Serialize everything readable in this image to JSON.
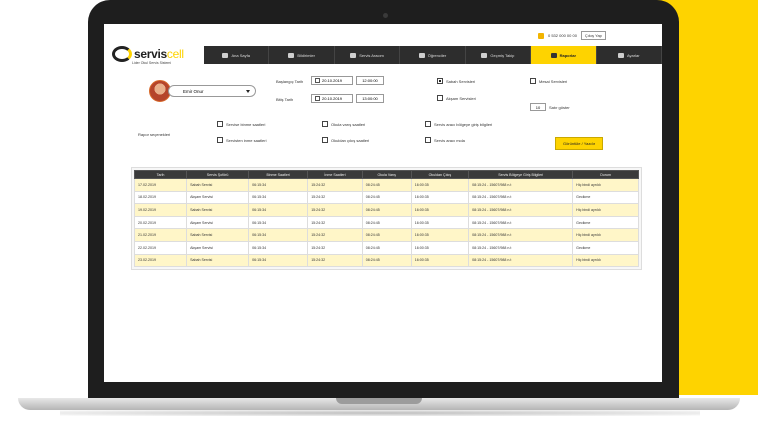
{
  "util": {
    "phone": "0 532 000 00 00",
    "exit_label": "Çıkış Yap"
  },
  "logo": {
    "brand_main": "servis",
    "brand_accent": "cell",
    "tagline": "Lider Okul Servis Sistemi"
  },
  "nav": {
    "items": [
      {
        "label": "Ana Sayfa",
        "icon": "home-icon"
      },
      {
        "label": "Bildirimler",
        "icon": "megaphone-icon"
      },
      {
        "label": "Servis Aracım",
        "icon": "bus-icon"
      },
      {
        "label": "Öğrenciler",
        "icon": "students-icon"
      },
      {
        "label": "Geçmiş Takip",
        "icon": "history-icon"
      },
      {
        "label": "Raporlar",
        "icon": "chart-icon",
        "active": true
      },
      {
        "label": "Ayarlar",
        "icon": "gear-icon"
      }
    ]
  },
  "user": {
    "name": "Emir Onur"
  },
  "filters": {
    "start_label": "Başlangıç Tarih",
    "end_label": "Bitiş Tarih",
    "start_date": "20.10.2019",
    "start_time": "12:00:00",
    "end_date": "20.10.2019",
    "end_time": "13:00:00",
    "opt_sabah": "Sabah Servisleri",
    "opt_mesai": "Mesai Servisleri",
    "opt_aksam": "Akşam Servisleri",
    "page_size": "10",
    "page_size_label": "Satır göster"
  },
  "report": {
    "label": "Rapor seçenekleri",
    "options": [
      "Servise binme saatleri",
      "Servisten inme saatleri",
      "Okula varış saatleri",
      "Okuldan çıkış saatleri",
      "Servis aracı bölgeye giriş bilgileri",
      "Servis aracı mola"
    ],
    "button": "Görüntüle / Yazdır"
  },
  "table": {
    "headers": [
      "Tarih",
      "Servis Şoförü",
      "Binme Saatleri",
      "İnme Saatleri",
      "Okula Varış",
      "Okuldan Çıkış",
      "Servis Bölgeye Giriş Bilgileri",
      "Durum"
    ],
    "rows": [
      [
        "17.02.2019",
        "Sabah Servisi",
        "06:15:34",
        "15:24:32",
        "08:24:45",
        "16:00:35",
        "08:15:24 - 15607/988 n.t",
        "Hiç bindi ayrıldı"
      ],
      [
        "18.02.2019",
        "Akşam Servisi",
        "06:15:34",
        "15:24:32",
        "08:24:45",
        "16:00:35",
        "08:15:24 - 15607/988 n.t",
        "Gecikme"
      ],
      [
        "19.02.2019",
        "Sabah Servisi",
        "06:15:34",
        "15:24:32",
        "08:24:45",
        "16:00:35",
        "08:15:24 - 15607/988 n.t",
        "Hiç bindi ayrıldı"
      ],
      [
        "20.02.2019",
        "Akşam Servisi",
        "06:15:34",
        "15:24:32",
        "08:24:45",
        "16:00:35",
        "08:15:24 - 15607/988 n.t",
        "Gecikme"
      ],
      [
        "21.02.2019",
        "Sabah Servisi",
        "06:15:34",
        "15:24:32",
        "08:24:45",
        "16:00:35",
        "08:15:24 - 15607/988 n.t",
        "Hiç bindi ayrıldı"
      ],
      [
        "22.02.2019",
        "Akşam Servisi",
        "06:15:34",
        "15:24:32",
        "08:24:45",
        "16:00:35",
        "08:15:24 - 15607/988 n.t",
        "Gecikme"
      ],
      [
        "23.02.2019",
        "Sabah Servisi",
        "06:15:34",
        "15:24:32",
        "08:24:45",
        "16:00:35",
        "08:15:24 - 15607/988 n.t",
        "Hiç bindi ayrıldı"
      ]
    ]
  },
  "colors": {
    "accent": "#fed300",
    "dark": "#2d2d2d",
    "row_highlight": "#fff6c8"
  }
}
